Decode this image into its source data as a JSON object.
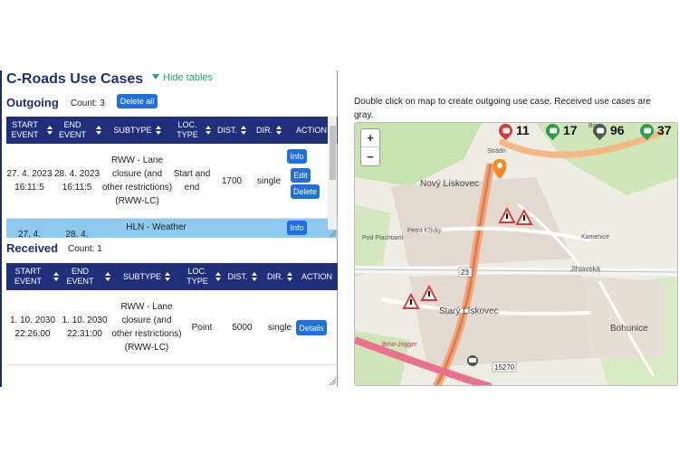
{
  "title": "C-Roads Use Cases",
  "hide_tables": "Hide tables",
  "outgoing": {
    "title": "Outgoing",
    "count": "Count: 3",
    "delete_all": "Delete all",
    "headers": [
      "START EVENT",
      "END EVENT",
      "SUBTYPE",
      "LOC. TYPE",
      "DIST.",
      "DIR.",
      "ACTION"
    ],
    "rows": [
      {
        "start": "27. 4. 2023 16:11:5",
        "end": "28. 4. 2023 16:11:5",
        "subtype": "RWW - Lane closure (and other restrictions) (RWW-LC)",
        "loc_type": "Start and end",
        "dist": "1700",
        "dir": "single",
        "actions": [
          "Info",
          "Edit",
          "Delete"
        ]
      },
      {
        "start": "27. 4.",
        "end": "28. 4.",
        "subtype": "HLN - Weather",
        "loc_type": "",
        "dist": "",
        "dir": "",
        "actions": [
          "Info"
        ]
      }
    ]
  },
  "received": {
    "title": "Received",
    "count": "Count: 1",
    "headers": [
      "START EVENT",
      "END EVENT",
      "SUBTYPE",
      "LOC. TYPE",
      "DIST.",
      "DIR.",
      "ACTION"
    ],
    "rows": [
      {
        "start": "1. 10. 2030 22:26:00",
        "end": "1. 10. 2030 22:31:00",
        "subtype": "RWW - Lane closure (and other restrictions) (RWW-LC)",
        "loc_type": "Point",
        "dist": "5000",
        "dir": "single",
        "actions": [
          "Details"
        ]
      }
    ]
  },
  "map": {
    "caption": "Double click on map to create outgoing use case. Received use cases are gray.",
    "zoom_in": "+",
    "zoom_out": "−",
    "stats": [
      {
        "value": "11",
        "color": "#d93b3b",
        "icon": "car-alert-icon"
      },
      {
        "value": "17",
        "color": "#2e9a4e",
        "icon": "car-icon"
      },
      {
        "value": "96",
        "color": "#555555",
        "icon": "car-icon"
      },
      {
        "value": "37",
        "color": "#2e9a4e",
        "icon": "car-icon"
      }
    ],
    "labels": {
      "novy_liskovec": "Nový Lískovec",
      "stary_liskovec": "Starý Lískovec",
      "bohunice": "Bohunice",
      "road_23": "23",
      "road_15270": "15270",
      "jihlavska": "Jihlavská",
      "petra_krivky": "Petra Křivky",
      "pod_plachtami": "Pod Plachtami",
      "kamenice": "Kamenice",
      "brno": "Brno",
      "stradn": "Strádn",
      "brno_jogger": "Brno-Jogger"
    }
  },
  "colors": {
    "header_bg": "#1f2f7a",
    "button": "#1f6fe0",
    "accent_green": "#2aa86a",
    "selected_row": "#8ecaf0",
    "marker_orange": "#f08a24"
  }
}
